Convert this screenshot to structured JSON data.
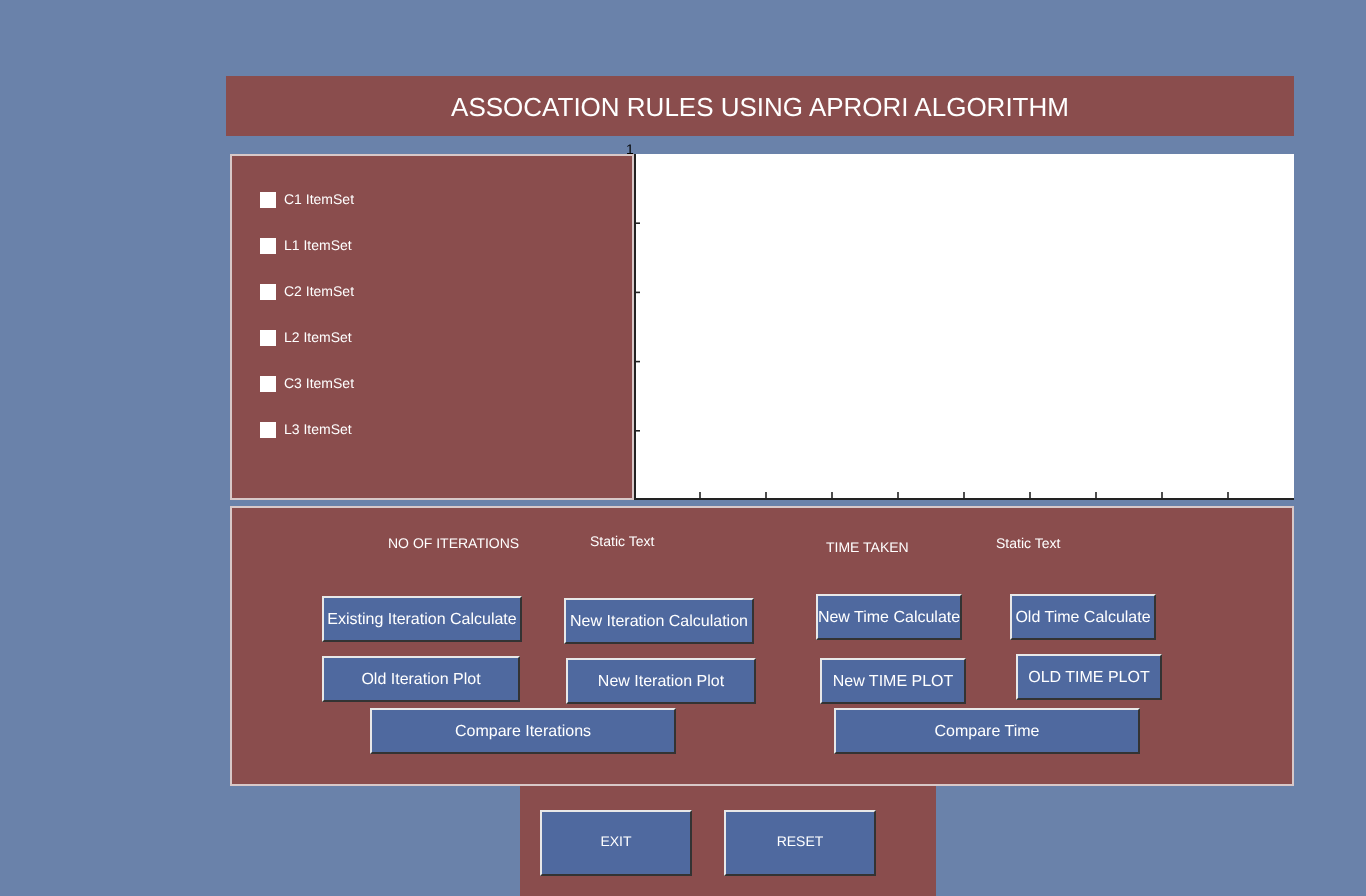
{
  "title": "ASSOCATION RULES USING APRORI ALGORITHM",
  "itemsets": [
    {
      "label": "C1 ItemSet",
      "checked": false
    },
    {
      "label": "L1 ItemSet",
      "checked": false
    },
    {
      "label": "C2 ItemSet",
      "checked": false
    },
    {
      "label": "L2 ItemSet",
      "checked": false
    },
    {
      "label": "C3 ItemSet",
      "checked": false
    },
    {
      "label": "L3 ItemSet",
      "checked": false
    }
  ],
  "plot": {
    "y_axis_top_label": "1"
  },
  "results": [
    {
      "label": "NO OF ITERATIONS"
    },
    {
      "label": "Static Text"
    },
    {
      "label": "TIME TAKEN"
    },
    {
      "label": "Static Text"
    }
  ],
  "buttons": [
    "Existing Iteration Calculate",
    "New Iteration Calculation",
    "New Time Calculate",
    "Old Time Calculate",
    "Old Iteration Plot",
    "New Iteration Plot",
    "New TIME PLOT",
    "OLD TIME PLOT",
    "Compare Iterations",
    "Compare Time"
  ],
  "footer_buttons": [
    "EXIT",
    "RESET"
  ]
}
